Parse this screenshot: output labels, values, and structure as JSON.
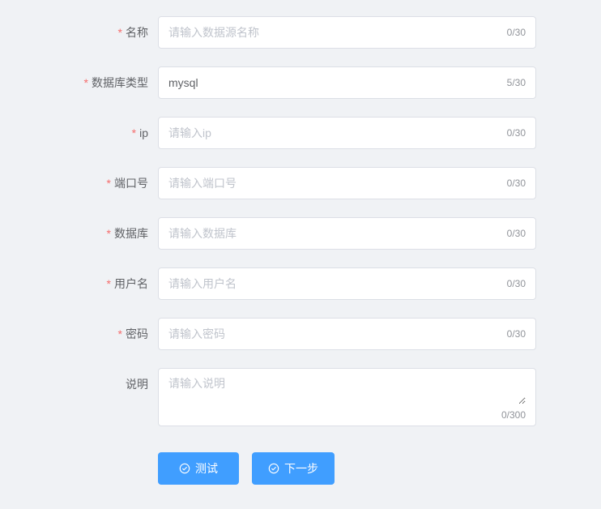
{
  "fields": {
    "name": {
      "label": "名称",
      "placeholder": "请输入数据源名称",
      "value": "",
      "count": "0/30",
      "required": true
    },
    "dbtype": {
      "label": "数据库类型",
      "placeholder": "",
      "value": "mysql",
      "count": "5/30",
      "required": true
    },
    "ip": {
      "label": "ip",
      "placeholder": "请输入ip",
      "value": "",
      "count": "0/30",
      "required": true
    },
    "port": {
      "label": "端口号",
      "placeholder": "请输入端口号",
      "value": "",
      "count": "0/30",
      "required": true
    },
    "database": {
      "label": "数据库",
      "placeholder": "请输入数据库",
      "value": "",
      "count": "0/30",
      "required": true
    },
    "username": {
      "label": "用户名",
      "placeholder": "请输入用户名",
      "value": "",
      "count": "0/30",
      "required": true
    },
    "password": {
      "label": "密码",
      "placeholder": "请输入密码",
      "value": "",
      "count": "0/30",
      "required": true
    },
    "description": {
      "label": "说明",
      "placeholder": "请输入说明",
      "value": "",
      "count": "0/300",
      "required": false
    }
  },
  "buttons": {
    "test": "测试",
    "next": "下一步"
  }
}
